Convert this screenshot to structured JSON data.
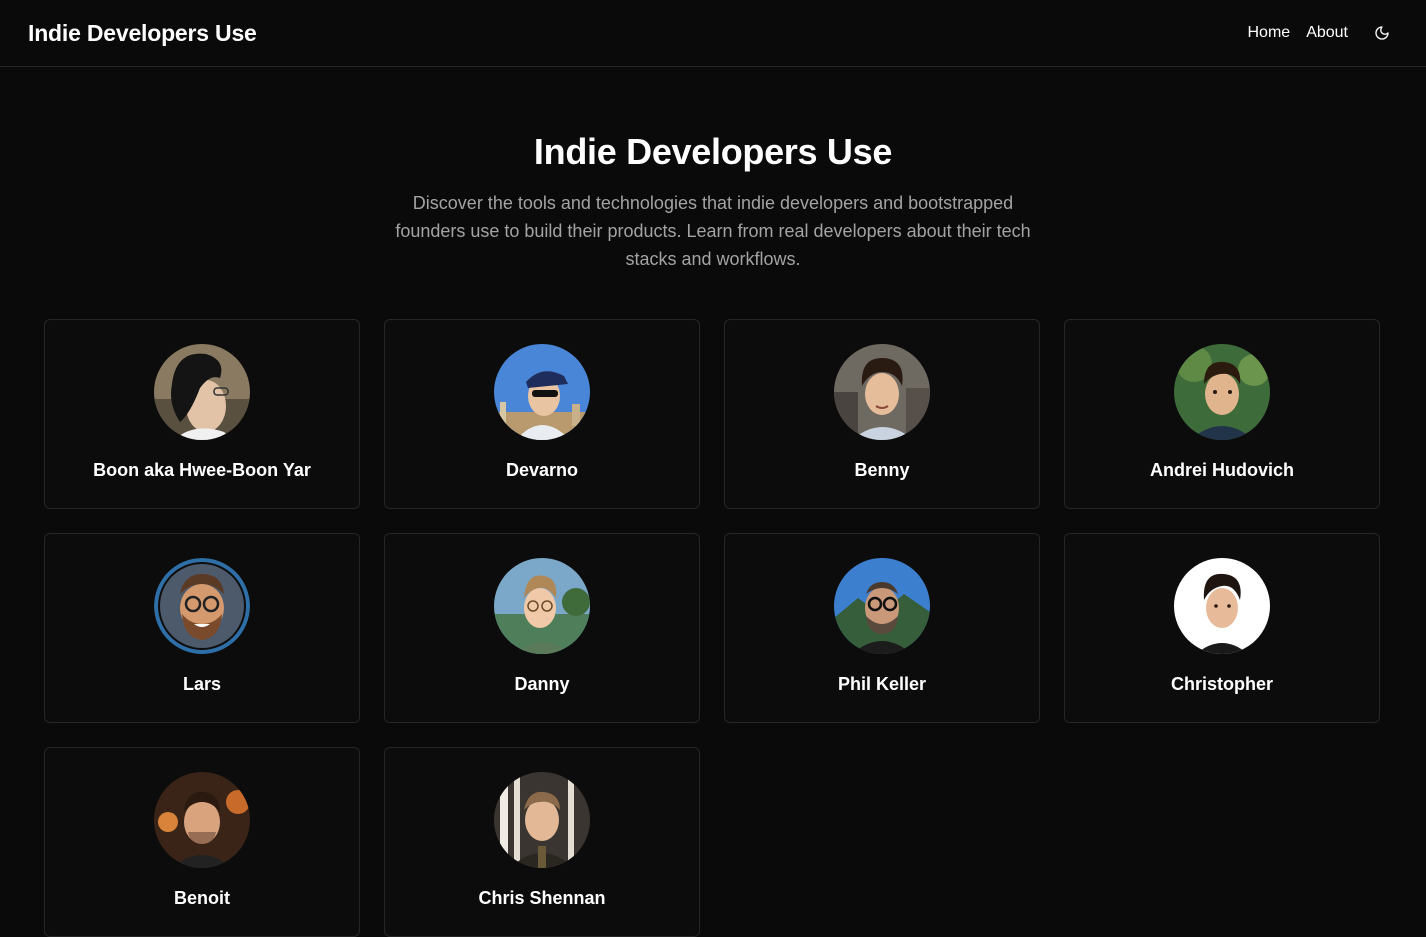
{
  "header": {
    "brand": "Indie Developers Use",
    "nav": [
      {
        "label": "Home"
      },
      {
        "label": "About"
      }
    ],
    "theme_icon": "moon-icon"
  },
  "hero": {
    "title": "Indie Developers Use",
    "description": "Discover the tools and technologies that indie developers and bootstrapped founders use to build their products. Learn from real developers about their tech stacks and workflows."
  },
  "developers": [
    {
      "name": "Boon aka Hwee-Boon Yar",
      "avatar": "boon"
    },
    {
      "name": "Devarno",
      "avatar": "devarno"
    },
    {
      "name": "Benny",
      "avatar": "benny"
    },
    {
      "name": "Andrei Hudovich",
      "avatar": "andrei"
    },
    {
      "name": "Lars",
      "avatar": "lars"
    },
    {
      "name": "Danny",
      "avatar": "danny"
    },
    {
      "name": "Phil Keller",
      "avatar": "phil"
    },
    {
      "name": "Christopher",
      "avatar": "christopher"
    },
    {
      "name": "Benoit",
      "avatar": "benoit"
    },
    {
      "name": "Chris Shennan",
      "avatar": "chris-shennan"
    }
  ]
}
